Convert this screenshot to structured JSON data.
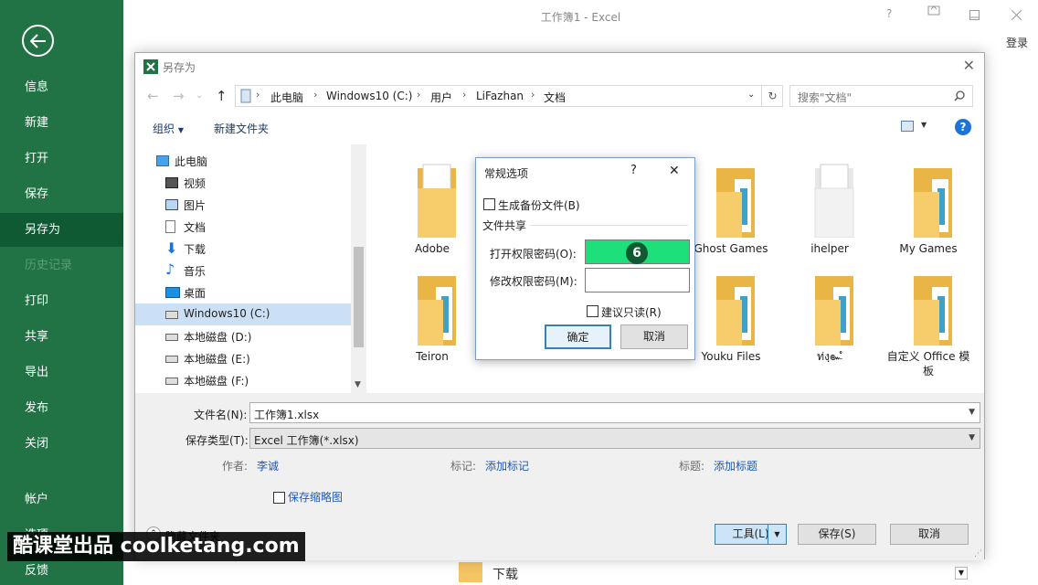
{
  "excel": {
    "window_title": "工作簿1 - Excel",
    "help_glyph": "?",
    "login": "登录"
  },
  "backstage": {
    "items": [
      {
        "label": "信息"
      },
      {
        "label": "新建"
      },
      {
        "label": "打开"
      },
      {
        "label": "保存"
      },
      {
        "label": "另存为",
        "active": true
      },
      {
        "label": "历史记录",
        "disabled": true
      },
      {
        "label": "打印"
      },
      {
        "label": "共享"
      },
      {
        "label": "导出"
      },
      {
        "label": "发布"
      },
      {
        "label": "关闭"
      },
      {
        "label": "帐户"
      },
      {
        "label": "选项"
      },
      {
        "label": "反馈"
      }
    ]
  },
  "save_as": {
    "title": "另存为",
    "breadcrumbs": [
      "此电脑",
      "Windows10 (C:)",
      "用户",
      "LiFazhan",
      "文档"
    ],
    "search_placeholder": "搜索\"文档\"",
    "organize": "组织",
    "new_folder": "新建文件夹",
    "help_glyph": "?",
    "nav_items": [
      {
        "label": "此电脑",
        "icon": "computer-icon"
      },
      {
        "label": "视频",
        "icon": "video-icon"
      },
      {
        "label": "图片",
        "icon": "pictures-icon"
      },
      {
        "label": "文档",
        "icon": "document-icon"
      },
      {
        "label": "下载",
        "icon": "download-icon"
      },
      {
        "label": "音乐",
        "icon": "music-icon"
      },
      {
        "label": "桌面",
        "icon": "desktop-icon"
      },
      {
        "label": "Windows10 (C:)",
        "icon": "drive-icon",
        "selected": true
      },
      {
        "label": "本地磁盘 (D:)",
        "icon": "drive-icon"
      },
      {
        "label": "本地磁盘 (E:)",
        "icon": "drive-icon"
      },
      {
        "label": "本地磁盘 (F:)",
        "icon": "drive-icon"
      }
    ],
    "folders": [
      {
        "label": "Adobe"
      },
      {
        "label": "Ghost Games"
      },
      {
        "label": "ihelper"
      },
      {
        "label": "My Games"
      },
      {
        "label": "Teiron"
      },
      {
        "label": "Youku Files"
      },
      {
        "label": "ท่งฺ๛ํ"
      },
      {
        "label": "自定义 Office 模板"
      }
    ],
    "filename_label": "文件名(N):",
    "filename_value": "工作簿1.xlsx",
    "filetype_label": "保存类型(T):",
    "filetype_value": "Excel 工作簿(*.xlsx)",
    "author_label": "作者:",
    "author_value": "李诚",
    "tags_label": "标记:",
    "tags_link": "添加标记",
    "title_label": "标题:",
    "title_link": "添加标题",
    "thumbnail_label": "保存缩略图",
    "hide_folders": "隐藏文件夹",
    "tools_button": "工具(L)",
    "save_button": "保存(S)",
    "cancel_button": "取消"
  },
  "general_options": {
    "title": "常规选项",
    "help_glyph": "?",
    "backup_label": "生成备份文件(B)",
    "sharing_heading": "文件共享",
    "open_password_label": "打开权限密码(O):",
    "modify_password_label": "修改权限密码(M):",
    "readonly_label": "建议只读(R)",
    "ok_button": "确定",
    "cancel_button": "取消",
    "step_number": "6",
    "highlight_color": "#1ee07a"
  },
  "watermark": "酷课堂出品 coolketang.com",
  "background_file": {
    "label": "下载"
  }
}
